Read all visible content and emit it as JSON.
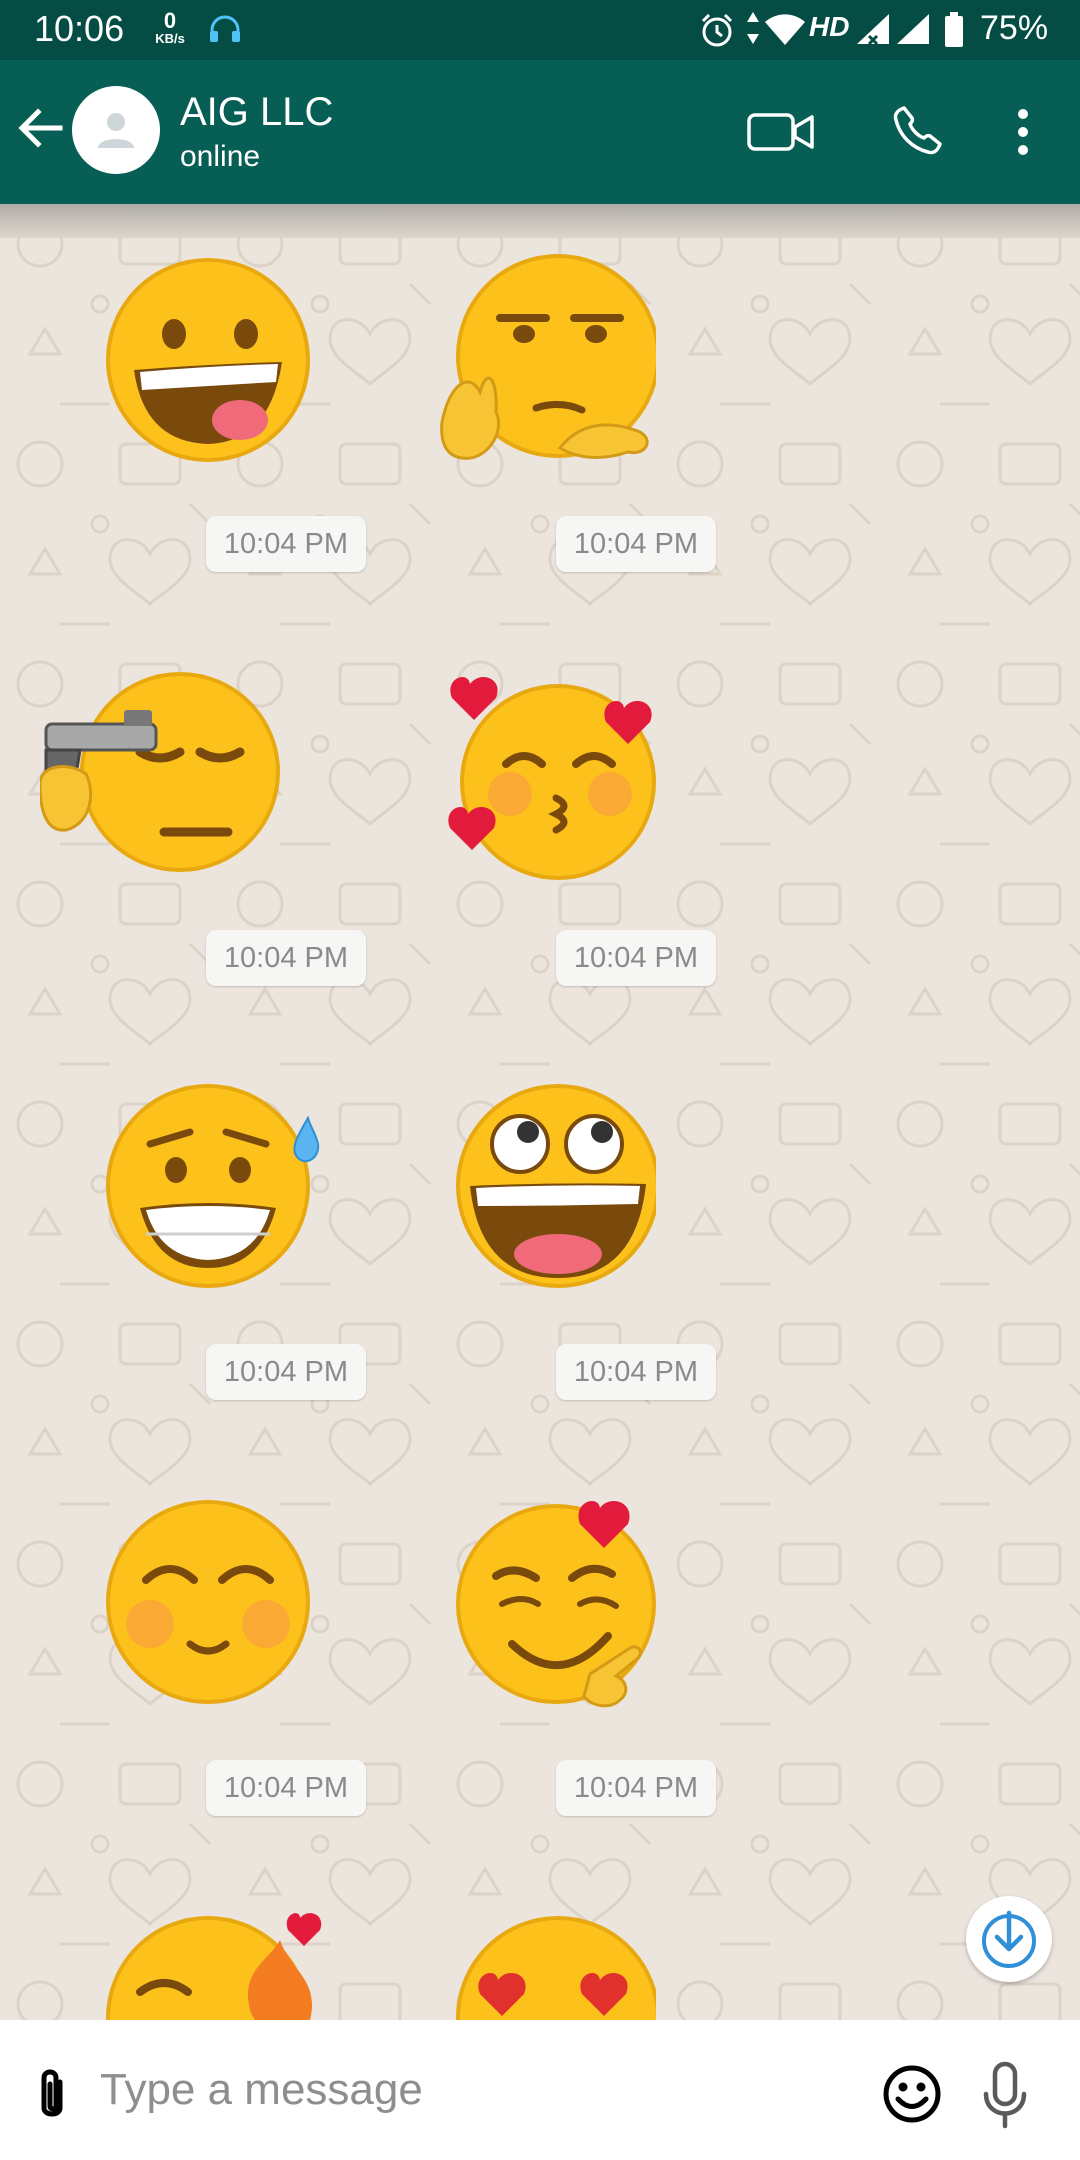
{
  "status_bar": {
    "time": "10:06",
    "net_speed_value": "0",
    "net_speed_unit": "KB/s",
    "network_type": "HD",
    "battery_percent": "75%",
    "icons": [
      "headset-icon",
      "alarm-icon",
      "data-arrows-icon",
      "wifi-icon",
      "signal-icon",
      "signal-icon",
      "battery-icon"
    ]
  },
  "toolbar": {
    "contact_name": "AIG LLC",
    "contact_status": "online",
    "icons": [
      "back-arrow-icon",
      "avatar-icon",
      "video-call-icon",
      "phone-icon",
      "more-vert-icon"
    ]
  },
  "messages": [
    {
      "sticker": "grinning-face",
      "time": "10:04 PM"
    },
    {
      "sticker": "face-with-hands-pose",
      "time": "10:04 PM"
    },
    {
      "sticker": "face-with-gun",
      "time": "10:04 PM"
    },
    {
      "sticker": "kissing-face-with-hearts",
      "time": "10:04 PM"
    },
    {
      "sticker": "grinning-face-with-sweat",
      "time": "10:04 PM"
    },
    {
      "sticker": "eye-roll-laughing-face",
      "time": "10:04 PM"
    },
    {
      "sticker": "blushing-smiling-face",
      "time": "10:04 PM"
    },
    {
      "sticker": "smirking-face-with-heart",
      "time": "10:04 PM"
    },
    {
      "sticker": "winking-face-with-fire",
      "time": ""
    },
    {
      "sticker": "heart-eyes-face",
      "time": ""
    }
  ],
  "input_bar": {
    "placeholder": "Type a message",
    "value": "",
    "icons": [
      "attach-icon",
      "emoji-icon",
      "mic-icon"
    ]
  },
  "scroll_down_button": {
    "icon": "scroll-down-icon"
  },
  "colors": {
    "status_bar": "#054d44",
    "toolbar": "#075e54",
    "chat_background": "#ece5dd",
    "timestamp_text": "#8a8a8a",
    "accent_blue": "#2f8fd8",
    "emoji_yellow": "#fcc21b"
  }
}
